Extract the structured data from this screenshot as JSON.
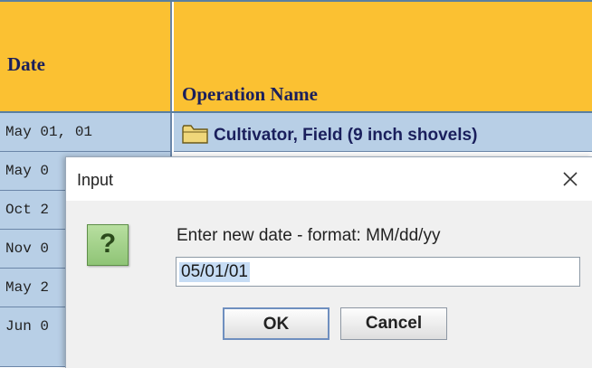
{
  "table": {
    "header_date": "Date",
    "header_operation": "Operation Name",
    "rows": [
      {
        "date": "May 01, 01",
        "operation": "Cultivator, Field (9 inch shovels)"
      },
      {
        "date": "May 0",
        "operation": ""
      },
      {
        "date": "Oct 2",
        "operation": ""
      },
      {
        "date": "Nov 0",
        "operation": ""
      },
      {
        "date": "May 2",
        "operation": ""
      },
      {
        "date": "Jun 0",
        "operation": ""
      }
    ]
  },
  "dialog": {
    "title": "Input",
    "prompt": "Enter new date - format: MM/dd/yy",
    "input_value": "05/01/01",
    "icon_glyph": "?",
    "ok_label": "OK",
    "cancel_label": "Cancel"
  },
  "colors": {
    "header_bg": "#fbc132",
    "row_bg": "#b8cfe6",
    "text_navy": "#1a1f5c"
  }
}
